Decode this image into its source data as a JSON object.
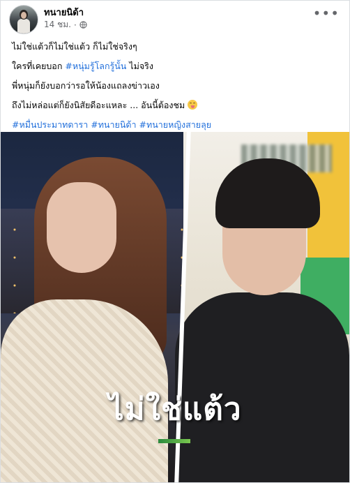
{
  "post": {
    "author": "ทนายนิด้า",
    "time": "14 ชม.",
    "time_separator": "·",
    "more_icon": "more-horizontal-icon",
    "privacy_icon": "globe-icon"
  },
  "text": {
    "line1": "ไม่ใช่แต้วก็ไม่ใช่แต้ว ก็ไม่ใช่จริงๆ",
    "line2_prefix": "ใครที่เคยบอก ",
    "line2_tag": "#หนุ่มรู้โลกรู้นั้น",
    "line2_suffix": " ไม่จริง",
    "line3": "พี่หนุ่มก็ยังบอกว่ารอให้น้องแถลงข่าวเอง",
    "line4": "ถึงไม่หล่อแต่ก็ยังนิสัยดีอะแหละ ... อันนี้ต้องชม ",
    "line4_emoji": "tongue-emoji",
    "hashtags": [
      "#หมื่นประมาทดารา",
      "#ทนายนิด้า",
      "#ทนายหญิงสายลุย"
    ]
  },
  "image": {
    "caption": "ไม่ใช่แต้ว"
  },
  "colors": {
    "link": "#216fdb",
    "secondary": "#65676b",
    "text": "#050505"
  }
}
